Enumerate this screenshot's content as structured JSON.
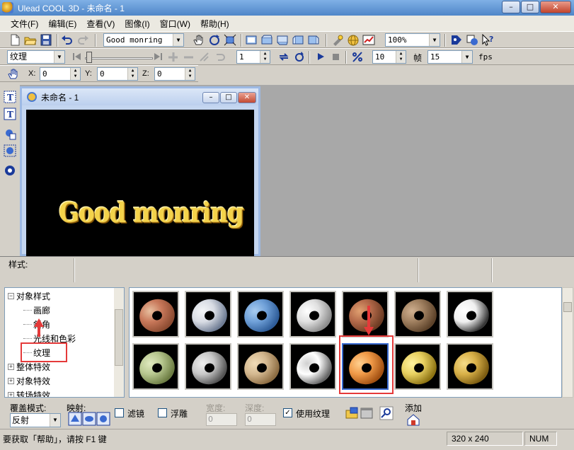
{
  "window": {
    "title": "Ulead COOL 3D - 未命名 - 1",
    "buttons": {
      "minimize": "–",
      "maximize": "□",
      "close": "✕"
    }
  },
  "menu": [
    "文件(F)",
    "编辑(E)",
    "查看(V)",
    "图像(I)",
    "窗口(W)",
    "帮助(H)"
  ],
  "toolbar1": {
    "text_value": "Good monring",
    "zoom_value": "100%"
  },
  "toolbar2": {
    "category_value": "纹理",
    "frame_value": "1",
    "frames_total": "10",
    "frames_label": "帧",
    "fps_value": "15",
    "fps_label": "fps"
  },
  "toolbar3": {
    "x_label": "X:",
    "x_value": "0",
    "y_label": "Y:",
    "y_value": "0",
    "z_label": "Z:",
    "z_value": "0"
  },
  "document": {
    "title": "未命名 - 1",
    "canvas_text": "Good monring"
  },
  "style_panel": {
    "label": "样式:"
  },
  "tree": {
    "items": [
      {
        "label": "对象样式",
        "toggle": "−",
        "level": 0
      },
      {
        "label": "画廊",
        "level": 1
      },
      {
        "label": "斜角",
        "level": 1
      },
      {
        "label": "光线和色彩",
        "level": 1
      },
      {
        "label": "纹理",
        "level": 1
      },
      {
        "label": "整体特效",
        "toggle": "+",
        "level": 0
      },
      {
        "label": "对象特效",
        "toggle": "+",
        "level": 0
      },
      {
        "label": "转场特效",
        "toggle": "+",
        "level": 0
      }
    ]
  },
  "thumbnails": {
    "selected_index": 11,
    "items": [
      {
        "name": "brick",
        "colors": [
          "#c8785a",
          "#8a4a30",
          "#e8c0a0"
        ]
      },
      {
        "name": "marble-blue-gray",
        "colors": [
          "#d8dce4",
          "#6a7890",
          "#f4f6f8"
        ]
      },
      {
        "name": "blue-pebble",
        "colors": [
          "#6fa0d8",
          "#2c5a96",
          "#a8ccf0"
        ]
      },
      {
        "name": "white-brick",
        "colors": [
          "#e0e0e0",
          "#8a8a8a",
          "#ffffff"
        ]
      },
      {
        "name": "wood-stripes",
        "colors": [
          "#b46a4a",
          "#6a3a22",
          "#e0a070"
        ]
      },
      {
        "name": "bark",
        "colors": [
          "#a08060",
          "#5a4028",
          "#d0b090"
        ]
      },
      {
        "name": "black-white-marble",
        "colors": [
          "#f0f0f0",
          "#303030",
          "#ffffff"
        ]
      },
      {
        "name": "green-moss",
        "colors": [
          "#b8c890",
          "#6a7a40",
          "#e0eac0"
        ]
      },
      {
        "name": "gray-stone",
        "colors": [
          "#c8c8c8",
          "#505050",
          "#f0f0f0"
        ]
      },
      {
        "name": "sand",
        "colors": [
          "#d4b890",
          "#8a6a40",
          "#f0dcb8"
        ]
      },
      {
        "name": "chrome",
        "colors": [
          "#ffffff",
          "#606060",
          "#d0d0d0"
        ]
      },
      {
        "name": "copper-orange",
        "colors": [
          "#f09a48",
          "#a04e10",
          "#ffd090"
        ]
      },
      {
        "name": "gold",
        "colors": [
          "#e8d060",
          "#8a7010",
          "#fff2a0"
        ]
      },
      {
        "name": "brass",
        "colors": [
          "#d8b048",
          "#7a5a10",
          "#f4dc8a"
        ]
      }
    ]
  },
  "options": {
    "cover_mode_label": "覆盖模式:",
    "cover_mode_value": "反射",
    "mapping_label": "映射:",
    "filter_label": "滤镜",
    "emboss_label": "浮雕",
    "width_label": "宽度:",
    "width_value": "0",
    "depth_label": "深度:",
    "depth_value": "0",
    "use_texture_label": "使用纹理",
    "use_texture_checked": "✓",
    "add_label": "添加"
  },
  "status": {
    "help_text": "要获取「帮助」，请按 F1 键",
    "dimensions": "320 x 240",
    "num_label": "NUM"
  },
  "colors": {
    "highlight": "#e53a3a",
    "titlebar": "#4f86c8"
  }
}
